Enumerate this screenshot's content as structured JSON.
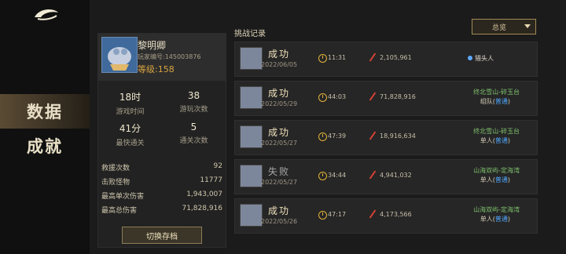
{
  "nav": {
    "data_label": "数据",
    "achievement_label": "成就"
  },
  "profile": {
    "name": "黎明卿",
    "player_id": "玩家编号:145003876",
    "level": "等级:158"
  },
  "stats": [
    {
      "value": "18时",
      "label": "游戏时间"
    },
    {
      "value": "38",
      "label": "游玩次数"
    },
    {
      "value": "41分",
      "label": "最快通关"
    },
    {
      "value": "5",
      "label": "通关次数"
    }
  ],
  "details": [
    {
      "label": "救援次数",
      "value": "92"
    },
    {
      "label": "击败怪物",
      "value": "11777"
    },
    {
      "label": "最高单次伤害",
      "value": "1,943,007"
    },
    {
      "label": "最高总伤害",
      "value": "71,828,916"
    }
  ],
  "switch_label": "切换存档",
  "challenge": {
    "title": "挑战记录",
    "filter": "总览"
  },
  "records": [
    {
      "result": "成功",
      "date": "2022/06/05",
      "time": "11:31",
      "damage": "2,105,961",
      "location": "",
      "mode": "",
      "tag": "猎头人",
      "fail": false
    },
    {
      "result": "成功",
      "date": "2022/05/29",
      "time": "44:03",
      "damage": "71,828,916",
      "location": "终北雪山-碎玉台",
      "mode": "组队",
      "difficulty": "普通",
      "tag": "",
      "fail": false
    },
    {
      "result": "成功",
      "date": "2022/05/27",
      "time": "47:39",
      "damage": "18,916,634",
      "location": "终北雪山-碎玉台",
      "mode": "单人",
      "difficulty": "普通",
      "tag": "",
      "fail": false
    },
    {
      "result": "失败",
      "date": "2022/05/27",
      "time": "34:44",
      "damage": "4,941,032",
      "location": "山海双屿-定海湾",
      "mode": "单人",
      "difficulty": "普通",
      "tag": "",
      "fail": true
    },
    {
      "result": "成功",
      "date": "2022/05/26",
      "time": "47:17",
      "damage": "4,173,566",
      "location": "山海双屿-定海湾",
      "mode": "单人",
      "difficulty": "普通",
      "tag": "",
      "fail": false
    }
  ]
}
